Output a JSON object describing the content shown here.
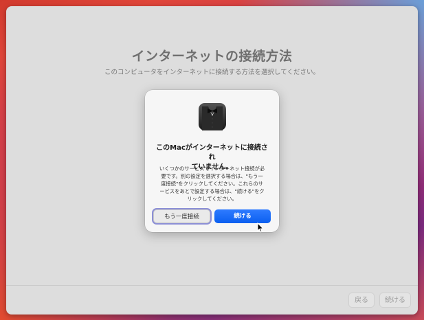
{
  "page": {
    "title": "インターネットの接続方法",
    "subtitle": "このコンピュータをインターネットに接続する方法を選択してください。"
  },
  "footer": {
    "back_label": "戻る",
    "continue_label": "続ける"
  },
  "dialog": {
    "icon": "bowtie-tuxedo-icon",
    "title_line1": "このMacがインターネットに接続され",
    "title_line2": "ていません。",
    "message_lines": [
      "いくつかのサービスでインターネット接続が必",
      "要です。別の設定を選択する場合は、\"もう一",
      "度接続\"をクリックしてください。これらのサ",
      "ービスをあとで設定する場合は、\"続ける\"をク",
      "リックしてください。"
    ],
    "retry_label": "もう一度接続",
    "continue_label": "続ける"
  },
  "colors": {
    "accent": "#0a5ff0",
    "focus_ring": "#8c8fd6"
  }
}
